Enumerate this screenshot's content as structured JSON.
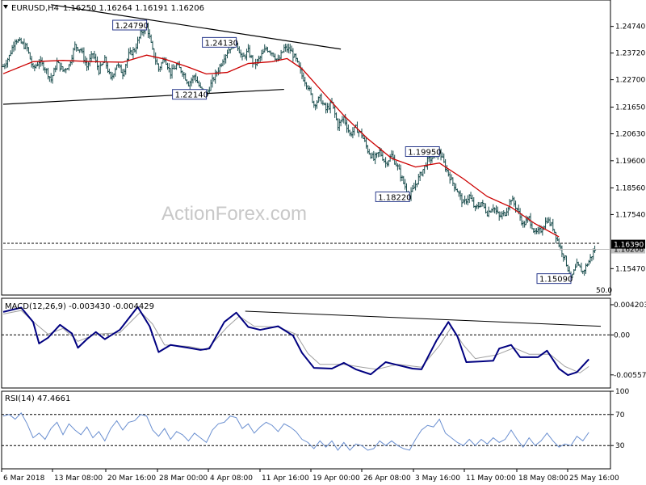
{
  "header": {
    "symbol": "EURUSD,H4",
    "ohlc": "1.16250 1.16264 1.16191 1.16206"
  },
  "watermark": "ActionForex.com",
  "colors": {
    "candle": "#1a4d4d",
    "ma": "#cc0000",
    "macd_main": "#000080",
    "macd_signal": "#a0a0a0",
    "rsi": "#6a8fd0",
    "trendline": "#000000",
    "bid_line": "#000000"
  },
  "chart_data": [
    {
      "type": "line",
      "name_text": "price",
      "y_ticks": [
        1.2474,
        1.2372,
        1.227,
        1.2165,
        1.2063,
        1.196,
        1.1856,
        1.1754,
        1.1547
      ],
      "y_tick_labels": [
        "1.24740",
        "1.23720",
        "1.22700",
        "1.21650",
        "1.20630",
        "1.19600",
        "1.18560",
        "1.17540",
        "1.15470"
      ],
      "ylim": [
        1.1446,
        1.2575
      ],
      "current_price": "1.16390",
      "last_price": "1.16206",
      "corner_label": "50.0",
      "x_tick_labels": [
        "6 Mar 2018",
        "13 Mar 08:00",
        "20 Mar 16:00",
        "28 Mar 00:00",
        "4 Apr 08:00",
        "11 Apr 16:00",
        "19 Apr 00:00",
        "26 Apr 08:00",
        "3 May 16:00",
        "11 May 00:00",
        "18 May 08:00",
        "25 May 16:00"
      ],
      "annotations": [
        "1.24790",
        "1.24130",
        "1.22140",
        "1.19950",
        "1.18220",
        "1.15090"
      ],
      "close_path": [
        [
          0,
          1.232
        ],
        [
          4,
          1.236
        ],
        [
          8,
          1.2425
        ],
        [
          12,
          1.241
        ],
        [
          16,
          1.239
        ],
        [
          20,
          1.231
        ],
        [
          24,
          1.234
        ],
        [
          28,
          1.2315
        ],
        [
          32,
          1.227
        ],
        [
          36,
          1.2335
        ],
        [
          40,
          1.2305
        ],
        [
          44,
          1.2325
        ],
        [
          48,
          1.24
        ],
        [
          52,
          1.2385
        ],
        [
          56,
          1.232
        ],
        [
          60,
          1.237
        ],
        [
          64,
          1.2305
        ],
        [
          68,
          1.2345
        ],
        [
          72,
          1.227
        ],
        [
          76,
          1.233
        ],
        [
          80,
          1.2295
        ],
        [
          84,
          1.2365
        ],
        [
          88,
          1.2385
        ],
        [
          92,
          1.2445
        ],
        [
          96,
          1.2479
        ],
        [
          100,
          1.238
        ],
        [
          104,
          1.231
        ],
        [
          108,
          1.2355
        ],
        [
          112,
          1.2295
        ],
        [
          116,
          1.2325
        ],
        [
          120,
          1.23
        ],
        [
          124,
          1.2255
        ],
        [
          128,
          1.2285
        ],
        [
          132,
          1.2235
        ],
        [
          136,
          1.2214
        ],
        [
          140,
          1.2265
        ],
        [
          144,
          1.231
        ],
        [
          148,
          1.236
        ],
        [
          152,
          1.2395
        ],
        [
          156,
          1.2413
        ],
        [
          160,
          1.235
        ],
        [
          164,
          1.238
        ],
        [
          168,
          1.2325
        ],
        [
          172,
          1.2355
        ],
        [
          176,
          1.239
        ],
        [
          180,
          1.2375
        ],
        [
          184,
          1.234
        ],
        [
          188,
          1.239
        ],
        [
          192,
          1.2385
        ],
        [
          196,
          1.2345
        ],
        [
          200,
          1.2285
        ],
        [
          204,
          1.2245
        ],
        [
          208,
          1.2175
        ],
        [
          212,
          1.22
        ],
        [
          216,
          1.2155
        ],
        [
          220,
          1.218
        ],
        [
          224,
          1.2095
        ],
        [
          228,
          1.2125
        ],
        [
          232,
          1.206
        ],
        [
          236,
          1.2085
        ],
        [
          240,
          1.206
        ],
        [
          244,
          1.2
        ],
        [
          248,
          1.1965
        ],
        [
          252,
          1.1995
        ],
        [
          256,
          1.195
        ],
        [
          260,
          1.198
        ],
        [
          264,
          1.1935
        ],
        [
          268,
          1.1875
        ],
        [
          272,
          1.1822
        ],
        [
          276,
          1.187
        ],
        [
          280,
          1.1915
        ],
        [
          284,
          1.196
        ],
        [
          288,
          1.1975
        ],
        [
          292,
          1.1995
        ],
        [
          296,
          1.1935
        ],
        [
          300,
          1.1885
        ],
        [
          304,
          1.1845
        ],
        [
          308,
          1.1795
        ],
        [
          312,
          1.1825
        ],
        [
          316,
          1.1775
        ],
        [
          320,
          1.18
        ],
        [
          324,
          1.176
        ],
        [
          328,
          1.1785
        ],
        [
          332,
          1.1745
        ],
        [
          336,
          1.176
        ],
        [
          340,
          1.1815
        ],
        [
          344,
          1.1775
        ],
        [
          348,
          1.1715
        ],
        [
          352,
          1.174
        ],
        [
          356,
          1.168
        ],
        [
          360,
          1.1695
        ],
        [
          364,
          1.1735
        ],
        [
          368,
          1.1705
        ],
        [
          372,
          1.164
        ],
        [
          376,
          1.1585
        ],
        [
          380,
          1.1509
        ],
        [
          384,
          1.156
        ],
        [
          388,
          1.1535
        ],
        [
          392,
          1.1575
        ],
        [
          396,
          1.1621
        ]
      ],
      "ma_path": [
        [
          0,
          1.2293
        ],
        [
          20,
          1.2339
        ],
        [
          40,
          1.2344
        ],
        [
          60,
          1.2339
        ],
        [
          80,
          1.2337
        ],
        [
          96,
          1.2364
        ],
        [
          108,
          1.2349
        ],
        [
          124,
          1.2318
        ],
        [
          136,
          1.2292
        ],
        [
          150,
          1.2298
        ],
        [
          164,
          1.2332
        ],
        [
          180,
          1.2339
        ],
        [
          190,
          1.2351
        ],
        [
          200,
          1.2312
        ],
        [
          214,
          1.2222
        ],
        [
          228,
          1.2133
        ],
        [
          244,
          1.2044
        ],
        [
          260,
          1.1969
        ],
        [
          276,
          1.1936
        ],
        [
          292,
          1.1951
        ],
        [
          308,
          1.1891
        ],
        [
          324,
          1.1823
        ],
        [
          340,
          1.1782
        ],
        [
          356,
          1.1719
        ],
        [
          372,
          1.1669
        ]
      ],
      "trendlines": [
        [
          [
            32,
            1.2557
          ],
          [
            226,
            1.2387
          ]
        ],
        [
          [
            0,
            1.2176
          ],
          [
            188,
            1.2233
          ]
        ],
        [
          [
            0,
            1.1644
          ],
          [
            400,
            1.1644
          ]
        ]
      ]
    },
    {
      "type": "line",
      "label": "MACD(12,26,9) -0.003430 -0.004429",
      "y_ticks": [
        0.004203,
        0.0,
        -0.005574
      ],
      "y_tick_labels": [
        "0.004203",
        "0.00",
        "-0.005574"
      ],
      "ylim": [
        -0.0074,
        0.0051
      ],
      "main": [
        [
          0,
          0.0032
        ],
        [
          12,
          0.0038
        ],
        [
          20,
          0.0018
        ],
        [
          24,
          -0.0012
        ],
        [
          30,
          -0.0004
        ],
        [
          38,
          0.0014
        ],
        [
          46,
          0.0002
        ],
        [
          50,
          -0.0018
        ],
        [
          56,
          -0.0006
        ],
        [
          62,
          0.0004
        ],
        [
          68,
          -0.0006
        ],
        [
          78,
          0.0007
        ],
        [
          90,
          0.0039
        ],
        [
          98,
          0.0012
        ],
        [
          104,
          -0.0024
        ],
        [
          112,
          -0.0014
        ],
        [
          124,
          -0.0018
        ],
        [
          132,
          -0.0021
        ],
        [
          138,
          -0.0019
        ],
        [
          148,
          0.0018
        ],
        [
          156,
          0.0031
        ],
        [
          164,
          0.0011
        ],
        [
          172,
          0.0007
        ],
        [
          184,
          0.0012
        ],
        [
          194,
          -0.0001
        ],
        [
          200,
          -0.0025
        ],
        [
          208,
          -0.0046
        ],
        [
          220,
          -0.0047
        ],
        [
          228,
          -0.0039
        ],
        [
          236,
          -0.0048
        ],
        [
          246,
          -0.0055
        ],
        [
          256,
          -0.0038
        ],
        [
          262,
          -0.0041
        ],
        [
          274,
          -0.0047
        ],
        [
          280,
          -0.0048
        ],
        [
          290,
          -0.0008
        ],
        [
          298,
          0.0018
        ],
        [
          304,
          -0.0002
        ],
        [
          310,
          -0.0038
        ],
        [
          320,
          -0.0037
        ],
        [
          328,
          -0.0036
        ],
        [
          332,
          -0.0019
        ],
        [
          340,
          -0.0014
        ],
        [
          346,
          -0.0031
        ],
        [
          358,
          -0.0031
        ],
        [
          364,
          -0.0022
        ],
        [
          372,
          -0.0047
        ],
        [
          378,
          -0.0056
        ],
        [
          384,
          -0.0052
        ],
        [
          392,
          -0.0034
        ]
      ],
      "signal": [
        [
          0,
          0.0029
        ],
        [
          12,
          0.0034
        ],
        [
          22,
          0.0015
        ],
        [
          30,
          0.0001
        ],
        [
          40,
          0.0009
        ],
        [
          50,
          -0.0009
        ],
        [
          62,
          0.0001
        ],
        [
          78,
          0.0003
        ],
        [
          92,
          0.0032
        ],
        [
          100,
          0.0015
        ],
        [
          108,
          -0.0014
        ],
        [
          124,
          -0.0016
        ],
        [
          136,
          -0.0021
        ],
        [
          150,
          0.0011
        ],
        [
          158,
          0.0026
        ],
        [
          168,
          0.0012
        ],
        [
          184,
          0.0011
        ],
        [
          196,
          0.0001
        ],
        [
          204,
          -0.0026
        ],
        [
          212,
          -0.0041
        ],
        [
          228,
          -0.0041
        ],
        [
          240,
          -0.0045
        ],
        [
          250,
          -0.0048
        ],
        [
          264,
          -0.0041
        ],
        [
          280,
          -0.0045
        ],
        [
          292,
          -0.0015
        ],
        [
          300,
          0.0011
        ],
        [
          308,
          -0.0014
        ],
        [
          316,
          -0.0033
        ],
        [
          330,
          -0.0028
        ],
        [
          342,
          -0.0018
        ],
        [
          352,
          -0.0027
        ],
        [
          366,
          -0.0027
        ],
        [
          376,
          -0.0044
        ],
        [
          386,
          -0.0053
        ],
        [
          392,
          -0.0044
        ]
      ],
      "trendline": [
        [
          162,
          0.0033
        ],
        [
          400,
          0.0012
        ]
      ]
    },
    {
      "type": "line",
      "label": "RSI(14) 47.4661",
      "y_ticks": [
        100,
        70,
        30,
        0
      ],
      "y_tick_labels": [
        "100",
        "70",
        "30",
        "0"
      ],
      "ylim": [
        0,
        100
      ],
      "levels": [
        70,
        30
      ],
      "values": [
        [
          0,
          68
        ],
        [
          4,
          70
        ],
        [
          8,
          64
        ],
        [
          12,
          72
        ],
        [
          16,
          58
        ],
        [
          20,
          40
        ],
        [
          24,
          46
        ],
        [
          28,
          38
        ],
        [
          32,
          52
        ],
        [
          36,
          60
        ],
        [
          40,
          44
        ],
        [
          44,
          58
        ],
        [
          48,
          50
        ],
        [
          52,
          44
        ],
        [
          56,
          54
        ],
        [
          60,
          40
        ],
        [
          64,
          48
        ],
        [
          68,
          36
        ],
        [
          72,
          52
        ],
        [
          76,
          62
        ],
        [
          80,
          50
        ],
        [
          84,
          60
        ],
        [
          88,
          62
        ],
        [
          92,
          70
        ],
        [
          96,
          68
        ],
        [
          100,
          50
        ],
        [
          104,
          42
        ],
        [
          108,
          52
        ],
        [
          112,
          38
        ],
        [
          116,
          48
        ],
        [
          120,
          44
        ],
        [
          124,
          36
        ],
        [
          128,
          46
        ],
        [
          132,
          40
        ],
        [
          136,
          34
        ],
        [
          140,
          50
        ],
        [
          144,
          58
        ],
        [
          148,
          60
        ],
        [
          152,
          68
        ],
        [
          156,
          66
        ],
        [
          160,
          52
        ],
        [
          164,
          58
        ],
        [
          168,
          46
        ],
        [
          172,
          54
        ],
        [
          176,
          60
        ],
        [
          180,
          56
        ],
        [
          184,
          48
        ],
        [
          188,
          58
        ],
        [
          192,
          54
        ],
        [
          196,
          48
        ],
        [
          200,
          38
        ],
        [
          204,
          34
        ],
        [
          208,
          26
        ],
        [
          212,
          36
        ],
        [
          216,
          28
        ],
        [
          220,
          36
        ],
        [
          224,
          24
        ],
        [
          228,
          34
        ],
        [
          232,
          24
        ],
        [
          236,
          32
        ],
        [
          240,
          30
        ],
        [
          244,
          24
        ],
        [
          248,
          26
        ],
        [
          252,
          36
        ],
        [
          256,
          30
        ],
        [
          260,
          36
        ],
        [
          264,
          30
        ],
        [
          268,
          26
        ],
        [
          272,
          24
        ],
        [
          276,
          38
        ],
        [
          280,
          50
        ],
        [
          284,
          56
        ],
        [
          288,
          54
        ],
        [
          292,
          64
        ],
        [
          296,
          46
        ],
        [
          300,
          40
        ],
        [
          304,
          34
        ],
        [
          308,
          30
        ],
        [
          312,
          38
        ],
        [
          316,
          30
        ],
        [
          320,
          38
        ],
        [
          324,
          32
        ],
        [
          328,
          40
        ],
        [
          332,
          34
        ],
        [
          336,
          38
        ],
        [
          340,
          50
        ],
        [
          344,
          38
        ],
        [
          348,
          28
        ],
        [
          352,
          40
        ],
        [
          356,
          30
        ],
        [
          360,
          36
        ],
        [
          364,
          46
        ],
        [
          368,
          36
        ],
        [
          372,
          28
        ],
        [
          376,
          32
        ],
        [
          380,
          30
        ],
        [
          384,
          42
        ],
        [
          388,
          36
        ],
        [
          392,
          47
        ]
      ]
    }
  ]
}
